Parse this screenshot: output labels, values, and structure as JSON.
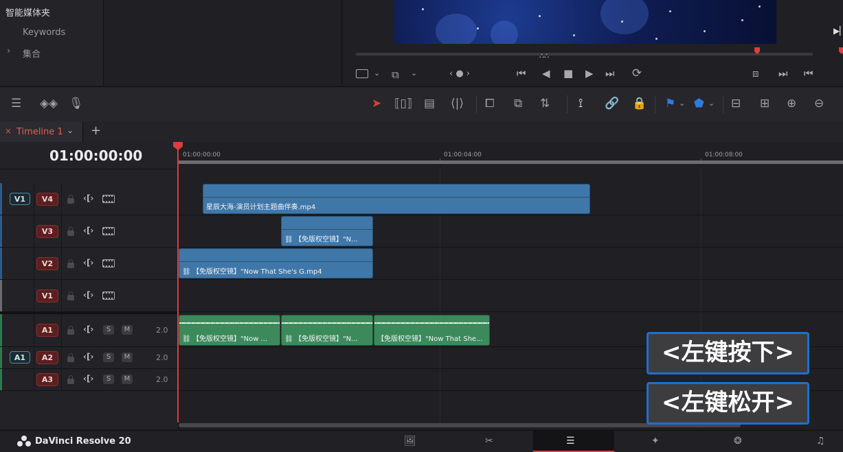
{
  "media_pool": {
    "smart_bins_title": "智能媒体夹",
    "keywords": "Keywords",
    "collections": "集合",
    "collections_chevron": "›"
  },
  "viewer": {
    "clip_icon": "film-icon",
    "controls": [
      "‹ ● ›",
      "⏮",
      "◀",
      "■",
      "▶",
      "⏭",
      "⟳"
    ],
    "right_controls": [
      "⧈",
      "⏭",
      "⏮"
    ]
  },
  "toolbar": {
    "selection_tool": "pointer-icon",
    "accent_color": "#e03c3c",
    "flag_color": "#2f7bdc",
    "marker_color": "#2f7bdc"
  },
  "timeline_tab": {
    "close": "×",
    "name": "Timeline 1",
    "chevron": "⌄",
    "add": "+"
  },
  "timecode": "01:00:00:00",
  "ruler": {
    "labels": [
      "01:00:00:00",
      "01:00:04:00",
      "01:00:08:00"
    ]
  },
  "tracks": {
    "video": [
      {
        "dest": "V1",
        "name": "V4"
      },
      {
        "dest": "",
        "name": "V3"
      },
      {
        "dest": "",
        "name": "V2"
      },
      {
        "dest": "",
        "name": "V1"
      }
    ],
    "audio": [
      {
        "dest": "",
        "name": "A1",
        "solo": "S",
        "mute": "M",
        "level": "2.0"
      },
      {
        "dest": "A1",
        "name": "A2",
        "solo": "S",
        "mute": "M",
        "level": "2.0"
      },
      {
        "dest": "",
        "name": "A3",
        "solo": "S",
        "mute": "M",
        "level": "2.0"
      }
    ],
    "trim_glyph": "‹[›"
  },
  "clips": {
    "v4": "星辰大海-演员计划主题曲伴奏.mp4",
    "v3": "【免版权空镜】\"N...",
    "v2": "【免版权空镜】\"Now That She's G.mp4",
    "a1_1": "【免版权空镜】\"Now ...",
    "a1_2": "【免版权空镜】\"N...",
    "a1_3": "【免版权空镜】\"Now That She...",
    "link_glyph": "🔗"
  },
  "overlays": {
    "press": "<左键按下>",
    "release": "<左键松开>"
  },
  "bottom": {
    "brand": "DaVinci Resolve 20",
    "active_page": "edit"
  }
}
